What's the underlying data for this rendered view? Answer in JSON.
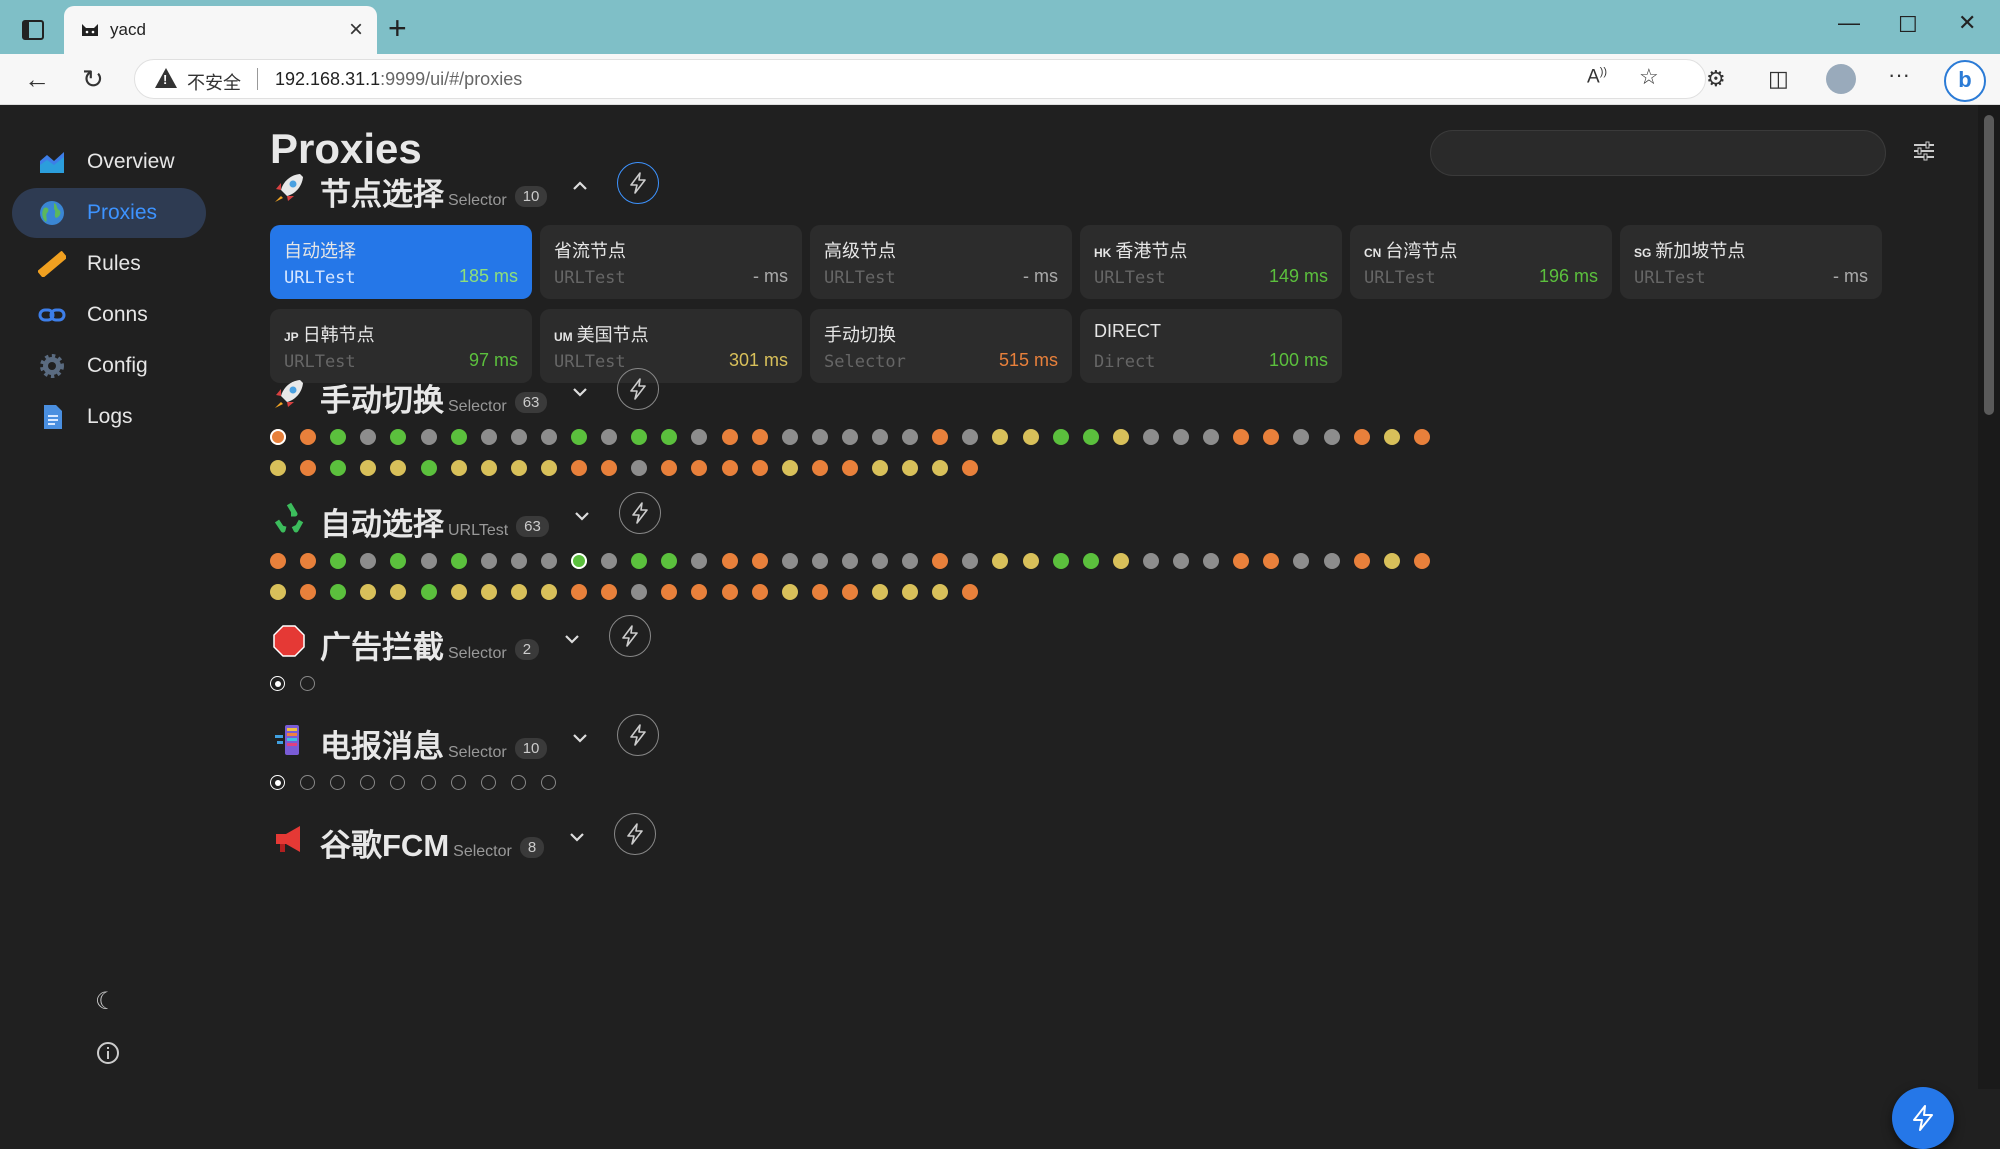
{
  "browser": {
    "tab_title": "yacd",
    "security_label": "不安全",
    "url_host": "192.168.31.1",
    "url_rest": ":9999/ui/#/proxies"
  },
  "sidebar": {
    "items": [
      {
        "label": "Overview",
        "icon": "chart-icon"
      },
      {
        "label": "Proxies",
        "icon": "globe-icon",
        "active": true
      },
      {
        "label": "Rules",
        "icon": "ruler-icon"
      },
      {
        "label": "Conns",
        "icon": "link-icon"
      },
      {
        "label": "Config",
        "icon": "gear-icon"
      },
      {
        "label": "Logs",
        "icon": "document-icon"
      }
    ]
  },
  "page": {
    "title": "Proxies"
  },
  "colors": {
    "accent": "#2577e8",
    "green": "#5bc03d",
    "yellow": "#d8c05a",
    "orange": "#e8803b",
    "gray": "#8d8d8d"
  },
  "groups": [
    {
      "name": "节点选择",
      "type": "Selector",
      "count": "10",
      "expanded": true,
      "proxies": [
        {
          "flag": "",
          "name": "自动选择",
          "type": "URLTest",
          "latency": "185 ms",
          "color": "green",
          "selected": true
        },
        {
          "flag": "",
          "name": "省流节点",
          "type": "URLTest",
          "latency": "- ms",
          "color": "gray"
        },
        {
          "flag": "",
          "name": "高级节点",
          "type": "URLTest",
          "latency": "- ms",
          "color": "gray"
        },
        {
          "flag": "HK",
          "name": "香港节点",
          "type": "URLTest",
          "latency": "149 ms",
          "color": "green"
        },
        {
          "flag": "CN",
          "name": "台湾节点",
          "type": "URLTest",
          "latency": "196 ms",
          "color": "green"
        },
        {
          "flag": "SG",
          "name": "新加坡节点",
          "type": "URLTest",
          "latency": "- ms",
          "color": "gray"
        },
        {
          "flag": "JP",
          "name": "日韩节点",
          "type": "URLTest",
          "latency": "97 ms",
          "color": "green"
        },
        {
          "flag": "UM",
          "name": "美国节点",
          "type": "URLTest",
          "latency": "301 ms",
          "color": "yellow"
        },
        {
          "flag": "",
          "name": "手动切换",
          "type": "Selector",
          "latency": "515 ms",
          "color": "orange"
        },
        {
          "flag": "",
          "name": "DIRECT",
          "type": "Direct",
          "latency": "100 ms",
          "color": "green"
        }
      ]
    },
    {
      "name": "手动切换",
      "type": "Selector",
      "count": "63",
      "expanded": false,
      "dots": [
        "O",
        "O",
        "G",
        "X",
        "G",
        "X",
        "G",
        "X",
        "X",
        "X",
        "G",
        "X",
        "G",
        "G",
        "X",
        "O",
        "O",
        "X",
        "X",
        "X",
        "X",
        "X",
        "O",
        "X",
        "Y",
        "Y",
        "G",
        "G",
        "Y",
        "X",
        "X",
        "X",
        "O",
        "O",
        "X",
        "X",
        "O",
        "Y",
        "O",
        "Y",
        "O",
        "G",
        "Y",
        "Y",
        "G",
        "Y",
        "Y",
        "Y",
        "Y",
        "O",
        "O",
        "X",
        "O",
        "O",
        "O",
        "O",
        "Y",
        "O",
        "O",
        "Y",
        "Y",
        "Y",
        "O"
      ],
      "selected_index": 0
    },
    {
      "name": "自动选择",
      "type": "URLTest",
      "count": "63",
      "expanded": false,
      "dots": [
        "O",
        "O",
        "G",
        "X",
        "G",
        "X",
        "G",
        "X",
        "X",
        "X",
        "G",
        "X",
        "G",
        "G",
        "X",
        "O",
        "O",
        "X",
        "X",
        "X",
        "X",
        "X",
        "O",
        "X",
        "Y",
        "Y",
        "G",
        "G",
        "Y",
        "X",
        "X",
        "X",
        "O",
        "O",
        "X",
        "X",
        "O",
        "Y",
        "O",
        "Y",
        "O",
        "G",
        "Y",
        "Y",
        "G",
        "Y",
        "Y",
        "Y",
        "Y",
        "O",
        "O",
        "X",
        "O",
        "O",
        "O",
        "O",
        "Y",
        "O",
        "O",
        "Y",
        "Y",
        "Y",
        "O"
      ],
      "selected_index": 10
    },
    {
      "name": "广告拦截",
      "type": "Selector",
      "count": "2",
      "expanded": false,
      "dots": [
        "S",
        "H"
      ]
    },
    {
      "name": "电报消息",
      "type": "Selector",
      "count": "10",
      "expanded": false,
      "dots": [
        "S",
        "H",
        "H",
        "H",
        "H",
        "H",
        "H",
        "H",
        "H",
        "H"
      ]
    },
    {
      "name": "谷歌FCM",
      "type": "Selector",
      "count": "8",
      "expanded": false,
      "dots": []
    }
  ]
}
